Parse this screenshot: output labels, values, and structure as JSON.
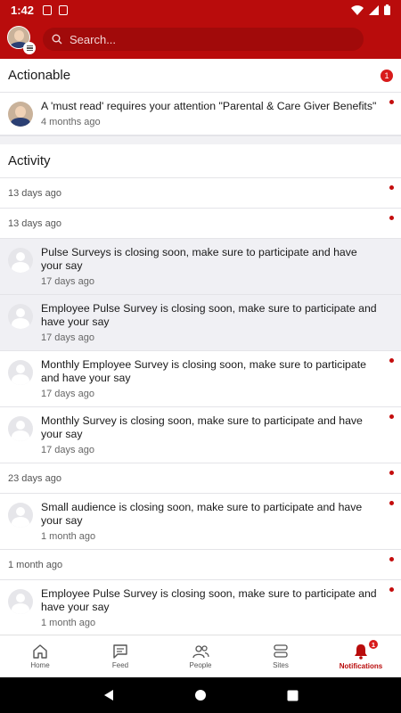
{
  "status_bar": {
    "time": "1:42"
  },
  "header": {
    "search_placeholder": "Search..."
  },
  "actionable": {
    "title": "Actionable",
    "badge_count": "1",
    "items": [
      {
        "text": "A 'must read' requires your attention \"Parental & Care Giver Benefits\"",
        "time": "4 months ago"
      }
    ]
  },
  "activity": {
    "title": "Activity",
    "date_row_1": "13 days ago",
    "date_row_2": "13 days ago",
    "items": [
      {
        "text": "Pulse Surveys is closing soon, make sure to participate and have your say",
        "time": "17 days ago"
      },
      {
        "text": "Employee Pulse Survey is closing soon, make sure to participate and have your say",
        "time": "17 days ago"
      },
      {
        "text": "Monthly Employee Survey is closing soon, make sure to participate and have your say",
        "time": "17 days ago"
      },
      {
        "text": "Monthly Survey is closing soon, make sure to participate and have your say",
        "time": "17 days ago"
      }
    ],
    "date_row_3": "23 days ago",
    "items_2": [
      {
        "text": "Small audience is closing soon, make sure to participate and have your say",
        "time": "1 month ago"
      }
    ],
    "date_row_4": "1 month ago",
    "items_3": [
      {
        "text": "Employee Pulse Survey is closing soon, make sure to participate and have your say",
        "time": "1 month ago"
      }
    ]
  },
  "bottom_nav": {
    "items": [
      {
        "label": "Home",
        "icon": "home-icon"
      },
      {
        "label": "Feed",
        "icon": "feed-icon"
      },
      {
        "label": "People",
        "icon": "people-icon"
      },
      {
        "label": "Sites",
        "icon": "sites-icon"
      },
      {
        "label": "Notifications",
        "icon": "bell-icon",
        "badge": "1"
      }
    ]
  },
  "colors": {
    "brand": "#b90c0c",
    "unread_dot": "#c40d0d",
    "badge": "#d81b1b"
  }
}
